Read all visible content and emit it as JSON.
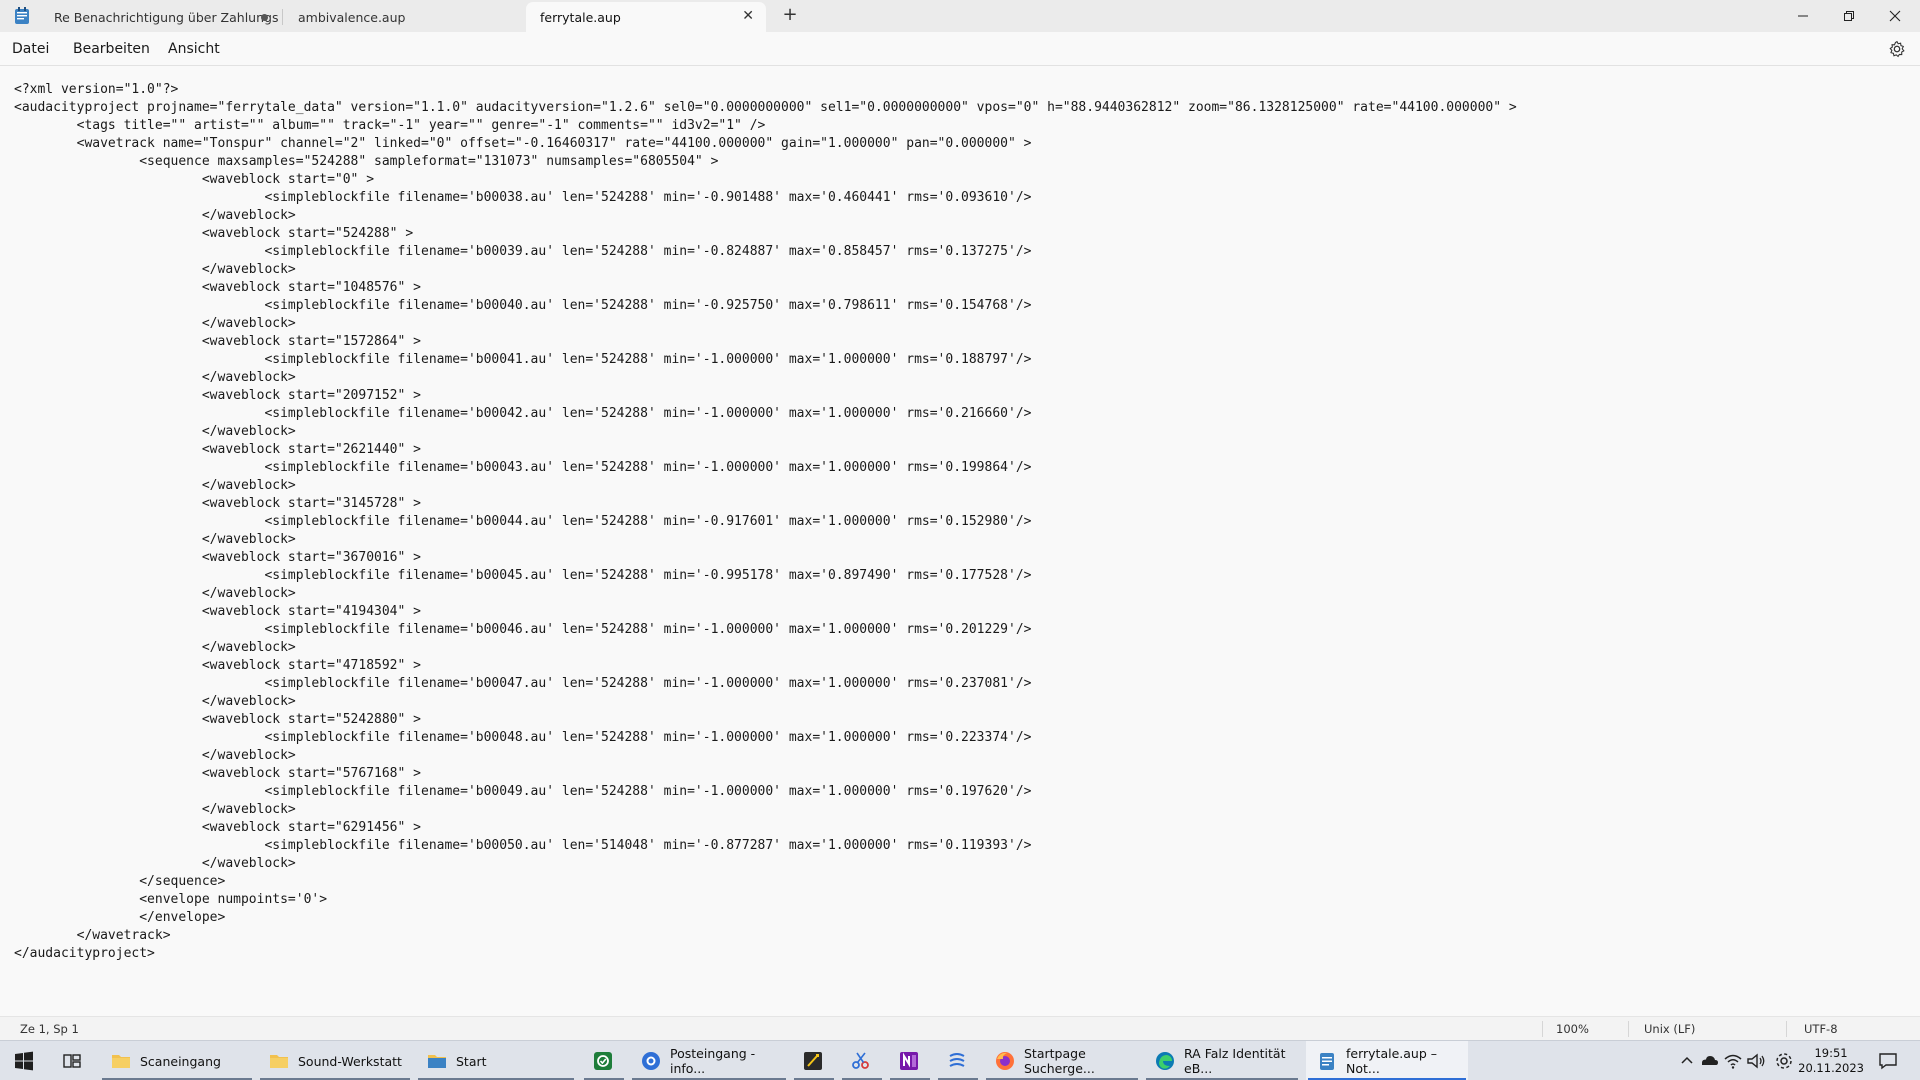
{
  "window": {
    "tabs": [
      {
        "label": "Re  Benachrichtigung über Zahlungs",
        "unsaved": true
      },
      {
        "label": "ambivalence.aup"
      },
      {
        "label": "ferrytale.aup",
        "active": true
      }
    ],
    "new_tab_label": "+",
    "controls": {
      "minimize": "–",
      "maximize": "▢",
      "close": "✕"
    }
  },
  "menu": {
    "items": [
      "Datei",
      "Bearbeiten",
      "Ansicht"
    ]
  },
  "editor": {
    "lines": [
      "<?xml version=\"1.0\"?>",
      "<audacityproject projname=\"ferrytale_data\" version=\"1.1.0\" audacityversion=\"1.2.6\" sel0=\"0.0000000000\" sel1=\"0.0000000000\" vpos=\"0\" h=\"88.9440362812\" zoom=\"86.1328125000\" rate=\"44100.000000\" >",
      "\t<tags title=\"\" artist=\"\" album=\"\" track=\"-1\" year=\"\" genre=\"-1\" comments=\"\" id3v2=\"1\" />",
      "\t<wavetrack name=\"Tonspur\" channel=\"2\" linked=\"0\" offset=\"-0.16460317\" rate=\"44100.000000\" gain=\"1.000000\" pan=\"0.000000\" >",
      "\t\t<sequence maxsamples=\"524288\" sampleformat=\"131073\" numsamples=\"6805504\" >",
      "\t\t\t<waveblock start=\"0\" >",
      "\t\t\t\t<simpleblockfile filename='b00038.au' len='524288' min='-0.901488' max='0.460441' rms='0.093610'/>",
      "\t\t\t</waveblock>",
      "\t\t\t<waveblock start=\"524288\" >",
      "\t\t\t\t<simpleblockfile filename='b00039.au' len='524288' min='-0.824887' max='0.858457' rms='0.137275'/>",
      "\t\t\t</waveblock>",
      "\t\t\t<waveblock start=\"1048576\" >",
      "\t\t\t\t<simpleblockfile filename='b00040.au' len='524288' min='-0.925750' max='0.798611' rms='0.154768'/>",
      "\t\t\t</waveblock>",
      "\t\t\t<waveblock start=\"1572864\" >",
      "\t\t\t\t<simpleblockfile filename='b00041.au' len='524288' min='-1.000000' max='1.000000' rms='0.188797'/>",
      "\t\t\t</waveblock>",
      "\t\t\t<waveblock start=\"2097152\" >",
      "\t\t\t\t<simpleblockfile filename='b00042.au' len='524288' min='-1.000000' max='1.000000' rms='0.216660'/>",
      "\t\t\t</waveblock>",
      "\t\t\t<waveblock start=\"2621440\" >",
      "\t\t\t\t<simpleblockfile filename='b00043.au' len='524288' min='-1.000000' max='1.000000' rms='0.199864'/>",
      "\t\t\t</waveblock>",
      "\t\t\t<waveblock start=\"3145728\" >",
      "\t\t\t\t<simpleblockfile filename='b00044.au' len='524288' min='-0.917601' max='1.000000' rms='0.152980'/>",
      "\t\t\t</waveblock>",
      "\t\t\t<waveblock start=\"3670016\" >",
      "\t\t\t\t<simpleblockfile filename='b00045.au' len='524288' min='-0.995178' max='0.897490' rms='0.177528'/>",
      "\t\t\t</waveblock>",
      "\t\t\t<waveblock start=\"4194304\" >",
      "\t\t\t\t<simpleblockfile filename='b00046.au' len='524288' min='-1.000000' max='1.000000' rms='0.201229'/>",
      "\t\t\t</waveblock>",
      "\t\t\t<waveblock start=\"4718592\" >",
      "\t\t\t\t<simpleblockfile filename='b00047.au' len='524288' min='-1.000000' max='1.000000' rms='0.237081'/>",
      "\t\t\t</waveblock>",
      "\t\t\t<waveblock start=\"5242880\" >",
      "\t\t\t\t<simpleblockfile filename='b00048.au' len='524288' min='-1.000000' max='1.000000' rms='0.223374'/>",
      "\t\t\t</waveblock>",
      "\t\t\t<waveblock start=\"5767168\" >",
      "\t\t\t\t<simpleblockfile filename='b00049.au' len='524288' min='-1.000000' max='1.000000' rms='0.197620'/>",
      "\t\t\t</waveblock>",
      "\t\t\t<waveblock start=\"6291456\" >",
      "\t\t\t\t<simpleblockfile filename='b00050.au' len='514048' min='-0.877287' max='1.000000' rms='0.119393'/>",
      "\t\t\t</waveblock>",
      "\t\t</sequence>",
      "\t\t<envelope numpoints='0'>",
      "\t\t</envelope>",
      "\t</wavetrack>",
      "</audacityproject>"
    ]
  },
  "status": {
    "position": "Ze 1, Sp 1",
    "zoom": "100%",
    "line_ending": "Unix (LF)",
    "encoding": "UTF-8"
  },
  "taskbar": {
    "items": [
      {
        "label": "Scaneingang",
        "icon": "folder-icon"
      },
      {
        "label": "Sound-Werkstatt",
        "icon": "folder-icon"
      },
      {
        "label": "Start",
        "icon": "folder-icon"
      },
      {
        "label": "",
        "icon": "security-app-icon"
      },
      {
        "label": "Posteingang - info...",
        "icon": "mail-app-icon"
      },
      {
        "label": "",
        "icon": "sticky-notes-icon"
      },
      {
        "label": "",
        "icon": "snipping-tool-icon"
      },
      {
        "label": "",
        "icon": "onenote-icon"
      },
      {
        "label": "",
        "icon": "app-icon"
      },
      {
        "label": "Startpage Sucherge...",
        "icon": "firefox-icon"
      },
      {
        "label": "RA Falz Identität eB...",
        "icon": "edge-icon"
      },
      {
        "label": "ferrytale.aup – Not...",
        "icon": "notepad-icon",
        "active": true
      }
    ],
    "clock_time": "19:51",
    "clock_date": "20.11.2023"
  },
  "colors": {
    "accent": "#2f6fd6",
    "folder": "#f2c14e",
    "notepad": "#3b82c4"
  }
}
